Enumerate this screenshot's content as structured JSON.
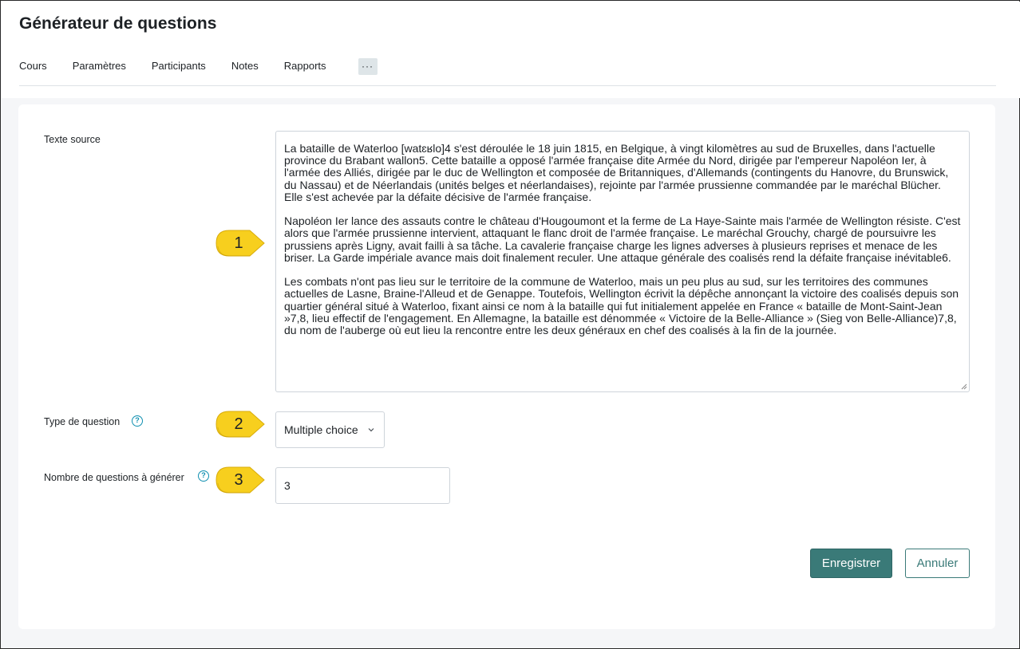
{
  "page": {
    "title": "Générateur de questions"
  },
  "tabs": [
    {
      "label": "Cours"
    },
    {
      "label": "Paramètres"
    },
    {
      "label": "Participants"
    },
    {
      "label": "Notes"
    },
    {
      "label": "Rapports"
    }
  ],
  "more_button": {
    "label": "···",
    "icon": "ellipsis-icon"
  },
  "form": {
    "source_text": {
      "label": "Texte source",
      "value": "La bataille de Waterloo [watɛʁlo]4 s'est déroulée le 18 juin 1815, en Belgique, à vingt kilomètres au sud de Bruxelles, dans l'actuelle province du Brabant wallon5. Cette bataille a opposé l'armée française dite Armée du Nord, dirigée par l'empereur Napoléon Ier, à l'armée des Alliés, dirigée par le duc de Wellington et composée de Britanniques, d'Allemands (contingents du Hanovre, du Brunswick, du Nassau) et de Néerlandais (unités belges et néerlandaises), rejointe par l'armée prussienne commandée par le maréchal Blücher. Elle s'est achevée par la défaite décisive de l'armée française.\n\nNapoléon Ier lance des assauts contre le château d'Hougoumont et la ferme de La Haye-Sainte mais l'armée de Wellington résiste. C'est alors que l'armée prussienne intervient, attaquant le flanc droit de l'armée française. Le maréchal Grouchy, chargé de poursuivre les prussiens après Ligny, avait failli à sa tâche. La cavalerie française charge les lignes adverses à plusieurs reprises et menace de les briser. La Garde impériale avance mais doit finalement reculer. Une attaque générale des coalisés rend la défaite française inévitable6.\n\nLes combats n'ont pas lieu sur le territoire de la commune de Waterloo, mais un peu plus au sud, sur les territoires des communes actuelles de Lasne, Braine-l'Alleud et de Genappe. Toutefois, Wellington écrivit la dépêche annonçant la victoire des coalisés depuis son quartier général situé à Waterloo, fixant ainsi ce nom à la bataille qui fut initialement appelée en France « bataille de Mont-Saint-Jean »7,8, lieu effectif de l'engagement. En Allemagne, la bataille est dénommée « Victoire de la Belle-Alliance » (Sieg von Belle-Alliance)7,8, du nom de l'auberge où eut lieu la rencontre entre les deux généraux en chef des coalisés à la fin de la journée."
    },
    "question_type": {
      "label": "Type de question",
      "selected": "Multiple choice",
      "help_icon": "question-circle-icon",
      "chevron_icon": "chevron-down-icon"
    },
    "question_count": {
      "label": "Nombre de questions à générer",
      "value": "3",
      "help_icon": "question-circle-icon"
    },
    "save_label": "Enregistrer",
    "cancel_label": "Annuler"
  },
  "callouts": [
    {
      "number": "1"
    },
    {
      "number": "2"
    },
    {
      "number": "3"
    }
  ],
  "colors": {
    "primary": "#3a7a78",
    "callout_fill": "#f7cf1e",
    "help_icon": "#0f8fb0",
    "background": "#f5f6f8"
  }
}
